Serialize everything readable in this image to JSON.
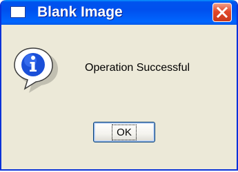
{
  "window": {
    "title": "Blank Image",
    "titlebar_color": "#0058e8",
    "icon": "window-icon",
    "close_icon": "close-icon"
  },
  "message": {
    "icon": "info-icon",
    "text": "Operation Successful"
  },
  "buttons": {
    "ok_label": "OK"
  }
}
